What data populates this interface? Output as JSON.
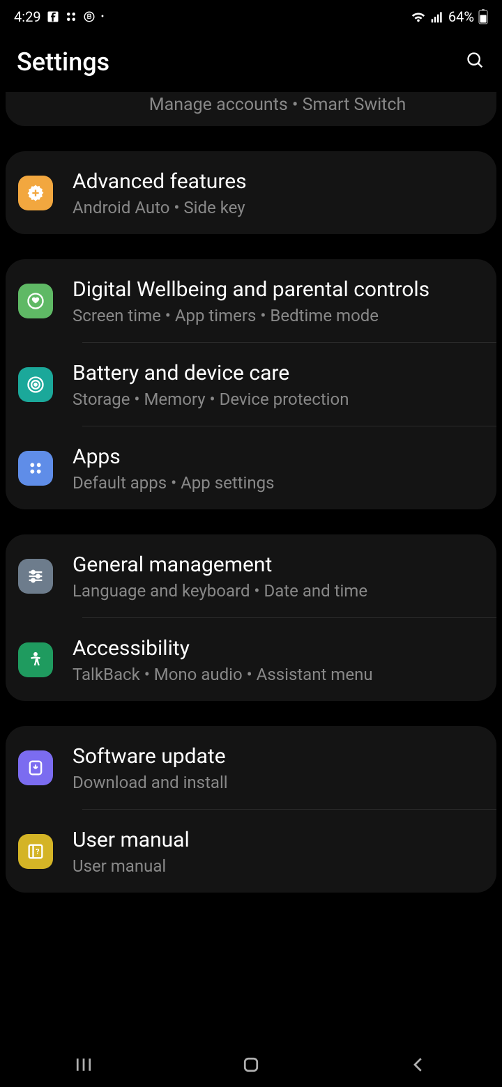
{
  "statusBar": {
    "time": "4:29",
    "battery": "64%"
  },
  "header": {
    "title": "Settings"
  },
  "peekItem": {
    "subtitle": "Manage accounts  •  Smart Switch"
  },
  "groups": [
    {
      "items": [
        {
          "id": "advanced-features",
          "title": "Advanced features",
          "subtitle": "Android Auto  •  Side key",
          "iconBg": "#f2a73f",
          "iconType": "gear-plus"
        }
      ]
    },
    {
      "items": [
        {
          "id": "digital-wellbeing",
          "title": "Digital Wellbeing and parental controls",
          "subtitle": "Screen time  •  App timers  •  Bedtime mode",
          "iconBg": "#5fb965",
          "iconType": "wellbeing"
        },
        {
          "id": "battery-device-care",
          "title": "Battery and device care",
          "subtitle": "Storage  •  Memory  •  Device protection",
          "iconBg": "#1ba89a",
          "iconType": "device-care"
        },
        {
          "id": "apps",
          "title": "Apps",
          "subtitle": "Default apps  •  App settings",
          "iconBg": "#5f8de8",
          "iconType": "apps"
        }
      ]
    },
    {
      "items": [
        {
          "id": "general-management",
          "title": "General management",
          "subtitle": "Language and keyboard  •  Date and time",
          "iconBg": "#6d7c8c",
          "iconType": "sliders"
        },
        {
          "id": "accessibility",
          "title": "Accessibility",
          "subtitle": "TalkBack  •  Mono audio  •  Assistant menu",
          "iconBg": "#1f9b5f",
          "iconType": "accessibility"
        }
      ]
    },
    {
      "items": [
        {
          "id": "software-update",
          "title": "Software update",
          "subtitle": "Download and install",
          "iconBg": "#7b6cf0",
          "iconType": "update"
        },
        {
          "id": "user-manual",
          "title": "User manual",
          "subtitle": "User manual",
          "iconBg": "#d4b426",
          "iconType": "manual"
        }
      ]
    }
  ]
}
